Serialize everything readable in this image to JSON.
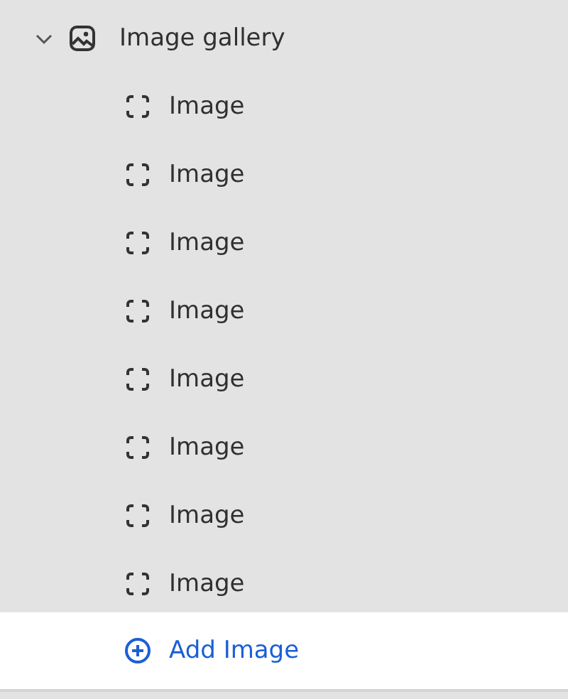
{
  "section": {
    "label": "Image gallery",
    "expanded": true,
    "children": [
      {
        "label": "Image"
      },
      {
        "label": "Image"
      },
      {
        "label": "Image"
      },
      {
        "label": "Image"
      },
      {
        "label": "Image"
      },
      {
        "label": "Image"
      },
      {
        "label": "Image"
      },
      {
        "label": "Image"
      }
    ],
    "add_button": {
      "label": "Add Image"
    }
  }
}
